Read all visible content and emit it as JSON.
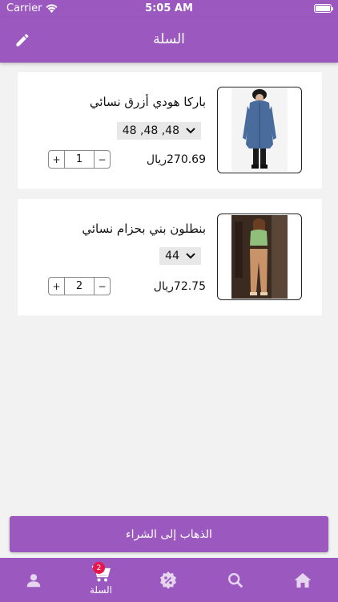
{
  "status_bar": {
    "carrier": "Carrier",
    "time": "5:05 AM"
  },
  "header": {
    "title": "السلة",
    "edit_icon": "pencil-icon"
  },
  "cart": {
    "items": [
      {
        "title": "باركا هودي أزرق نسائي",
        "size": "48 ,48 ,48",
        "price": "270.69",
        "currency": "ريال",
        "quantity": "1"
      },
      {
        "title": "بنطلون بني بحزام نسائي",
        "size": "44",
        "price": "72.75",
        "currency": "ريال",
        "quantity": "2"
      }
    ]
  },
  "checkout_label": "الذهاب إلى الشراء",
  "tab_bar": {
    "cart_label": "السلة",
    "cart_badge": "2",
    "icons": [
      "profile-icon",
      "cart-icon",
      "offers-icon",
      "search-icon",
      "home-icon"
    ]
  },
  "colors": {
    "primary": "#9b59c0",
    "badge": "#e8174b"
  }
}
